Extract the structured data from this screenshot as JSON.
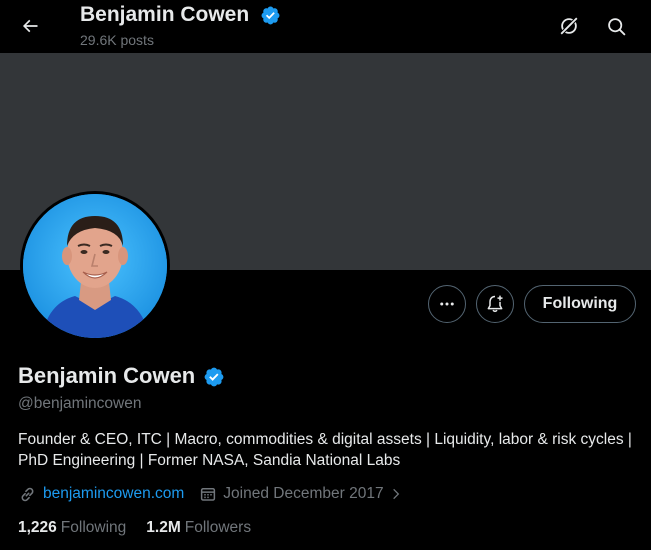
{
  "header": {
    "display_name": "Benjamin Cowen",
    "posts_count": "29.6K posts"
  },
  "profile": {
    "display_name": "Benjamin Cowen",
    "handle": "@benjamincowen",
    "bio": "Founder & CEO, ITC | Macro, commodities & digital assets | Liquidity, labor & risk cycles | PhD Engineering | Former NASA, Sandia National Labs",
    "website": "benjamincowen.com",
    "joined": "Joined December 2017",
    "following_count": "1,226",
    "following_label": "Following",
    "followers_count": "1.2M",
    "followers_label": "Followers"
  },
  "actions": {
    "following_button": "Following"
  },
  "icons": {
    "back": "arrow-left-icon",
    "grok": "grok-icon",
    "search": "search-icon",
    "more": "more-dots-icon",
    "notify": "bell-plus-icon",
    "verified": "verified-badge-icon",
    "link": "link-icon",
    "calendar": "calendar-icon",
    "chevron": "chevron-right-icon"
  },
  "colors": {
    "background": "#000000",
    "banner": "#333639",
    "accent": "#1d9bf0",
    "text_primary": "#e7e9ea",
    "text_secondary": "#71767b",
    "border": "#536471"
  }
}
